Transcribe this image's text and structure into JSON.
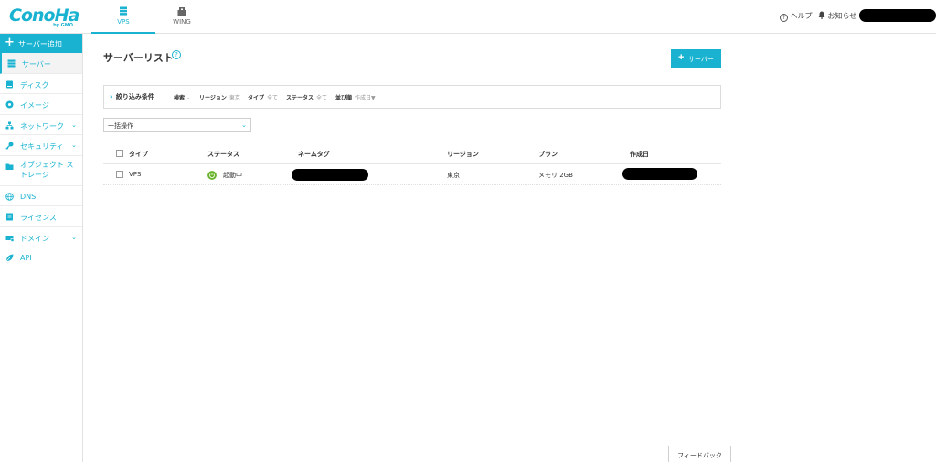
{
  "brand": {
    "name": "ConoHa",
    "sub": "by GMO",
    "accent": "#19b3d1"
  },
  "header": {
    "tabs": [
      {
        "label": "VPS",
        "icon": "vps-server-icon",
        "active": true
      },
      {
        "label": "WING",
        "icon": "wing-building-icon",
        "active": false
      }
    ],
    "help_label": "ヘルプ",
    "notice_label": "お知らせ"
  },
  "sidebar": {
    "add_label": "サーバー追加",
    "items": [
      {
        "label": "サーバー",
        "icon": "server-icon",
        "active": true,
        "has_chevron": false
      },
      {
        "label": "ディスク",
        "icon": "disk-icon",
        "active": false,
        "has_chevron": false
      },
      {
        "label": "イメージ",
        "icon": "image-globe-icon",
        "active": false,
        "has_chevron": false
      },
      {
        "label": "ネットワーク",
        "icon": "network-icon",
        "active": false,
        "has_chevron": true
      },
      {
        "label": "セキュリティ",
        "icon": "key-icon",
        "active": false,
        "has_chevron": true
      },
      {
        "label": "オブジェクト ストレージ",
        "icon": "folder-icon",
        "active": false,
        "has_chevron": false
      },
      {
        "label": "DNS",
        "icon": "dns-globe-icon",
        "active": false,
        "has_chevron": false
      },
      {
        "label": "ライセンス",
        "icon": "license-icon",
        "active": false,
        "has_chevron": false
      },
      {
        "label": "ドメイン",
        "icon": "domain-icon",
        "active": false,
        "has_chevron": true
      },
      {
        "label": "API",
        "icon": "api-leaf-icon",
        "active": false,
        "has_chevron": false
      }
    ]
  },
  "main": {
    "title": "サーバーリスト",
    "add_button_label": "サーバー",
    "filter": {
      "toggle_label": "絞り込み条件",
      "fields": [
        {
          "label": "検索",
          "value": "-"
        },
        {
          "label": "リージョン",
          "value": "東京"
        },
        {
          "label": "タイプ",
          "value": "全て"
        },
        {
          "label": "ステータス",
          "value": "全て"
        },
        {
          "label": "並び順",
          "value": "作成日▼"
        }
      ]
    },
    "bulk_select_label": "一括操作",
    "table": {
      "headers": [
        "タイプ",
        "ステータス",
        "ネームタグ",
        "リージョン",
        "プラン",
        "作成日"
      ],
      "rows": [
        {
          "type": "VPS",
          "status": "起動中",
          "region": "東京",
          "plan": "メモリ 2GB"
        }
      ]
    },
    "feedback_label": "フィードバック"
  }
}
